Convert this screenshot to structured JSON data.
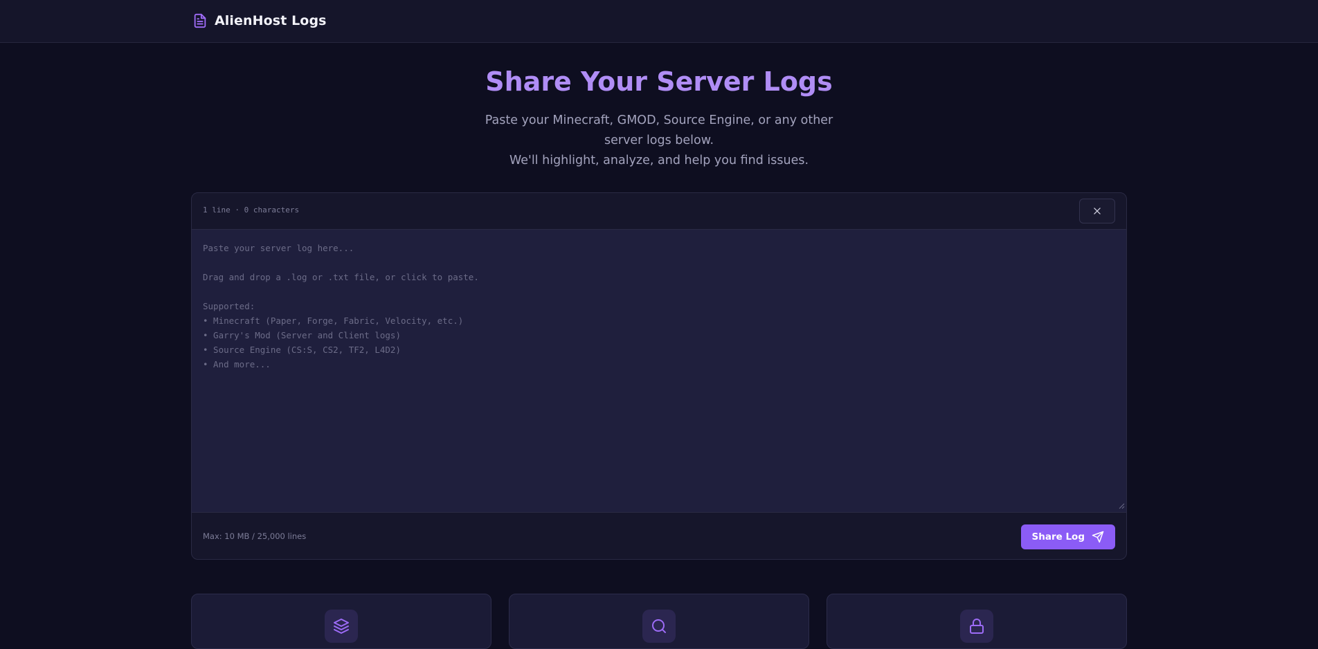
{
  "colors": {
    "accent": "#8b5cf6",
    "title": "#b08df5",
    "background": "#0e0e20",
    "panel": "#16162b"
  },
  "header": {
    "brand_icon": "document-icon",
    "brand_name": "AlienHost Logs"
  },
  "hero": {
    "title": "Share Your Server Logs",
    "subtitle_line1": "Paste your Minecraft, GMOD, Source Engine, or any other server logs below.",
    "subtitle_line2": "We'll highlight, analyze, and help you find issues."
  },
  "editor": {
    "stats": "1 line · 0 characters",
    "clear_icon": "close-icon",
    "value": "",
    "placeholder": "Paste your server log here...\n\nDrag and drop a .log or .txt file, or click to paste.\n\nSupported:\n• Minecraft (Paper, Forge, Fabric, Velocity, etc.)\n• Garry's Mod (Server and Client logs)\n• Source Engine (CS:S, CS2, TF2, L4D2)\n• And more...",
    "limit": "Max: 10 MB / 25,000 lines",
    "share_label": "Share Log",
    "share_icon": "send-icon"
  },
  "features": [
    {
      "icon": "layers-icon"
    },
    {
      "icon": "search-icon"
    },
    {
      "icon": "lock-icon"
    }
  ]
}
